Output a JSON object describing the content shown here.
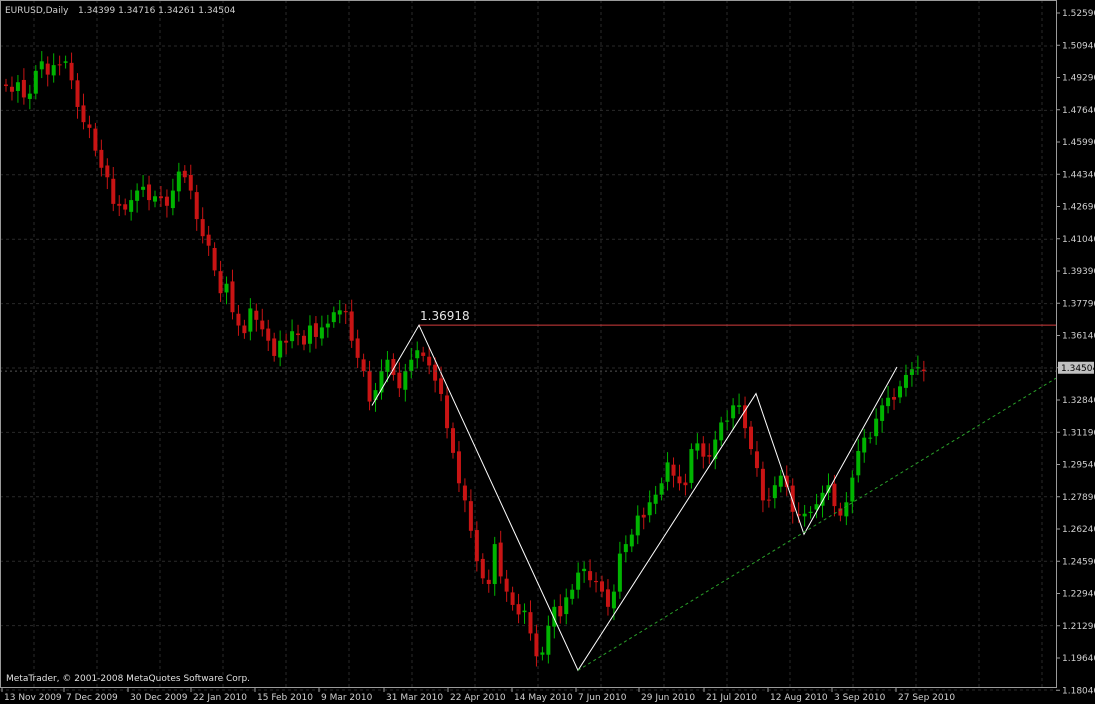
{
  "header": {
    "symbol": "EURUSD,Daily",
    "ohlc": "1.34399 1.34716 1.34261 1.34504"
  },
  "watermark": "MetaTrader, © 2001-2008 MetaQuotes Software Corp.",
  "colors": {
    "background": "#000000",
    "grid": "#2a2a2a",
    "bull": "#00b400",
    "bear": "#c81414",
    "zigzag": "#ffffff",
    "resistance": "#d23c3c",
    "trend": "#2aa02a",
    "price_bg": "#c0c0c0"
  },
  "chart_data": {
    "type": "candlestick",
    "ylim": [
      1.1804,
      1.5329
    ],
    "y_ticks": [
      "1.52590",
      "1.50940",
      "1.49290",
      "1.47640",
      "1.45990",
      "1.44340",
      "1.42690",
      "1.41040",
      "1.39390",
      "1.37790",
      "1.36140",
      "1.34504",
      "1.32840",
      "1.31190",
      "1.29540",
      "1.27890",
      "1.26240",
      "1.24590",
      "1.22940",
      "1.21290",
      "1.19640",
      "1.18040"
    ],
    "current_price": "1.34504",
    "x_labels": [
      "13 Nov 2009",
      "7 Dec 2009",
      "30 Dec 2009",
      "22 Jan 2010",
      "15 Feb 2010",
      "9 Mar 2010",
      "31 Mar 2010",
      "22 Apr 2010",
      "14 May 2010",
      "7 Jun 2010",
      "29 Jun 2010",
      "21 Jul 2010",
      "12 Aug 2010",
      "3 Sep 2010",
      "27 Sep 2010"
    ],
    "candle_count": 233,
    "closes": [
      1.495,
      1.492,
      1.497,
      1.489,
      1.491,
      1.503,
      1.508,
      1.501,
      1.506,
      1.506,
      1.508,
      1.498,
      1.484,
      1.476,
      1.473,
      1.461,
      1.452,
      1.447,
      1.433,
      1.432,
      1.43,
      1.435,
      1.44,
      1.442,
      1.435,
      1.437,
      1.436,
      1.432,
      1.44,
      1.45,
      1.447,
      1.44,
      1.425,
      1.416,
      1.411,
      1.398,
      1.386,
      1.391,
      1.376,
      1.369,
      1.365,
      1.378,
      1.372,
      1.367,
      1.361,
      1.353,
      1.361,
      1.36,
      1.366,
      1.364,
      1.359,
      1.369,
      1.363,
      1.368,
      1.37,
      1.376,
      1.377,
      1.376,
      1.361,
      1.352,
      1.345,
      1.329,
      1.335,
      1.345,
      1.351,
      1.343,
      1.336,
      1.345,
      1.351,
      1.356,
      1.353,
      1.348,
      1.34,
      1.333,
      1.315,
      1.302,
      1.286,
      1.277,
      1.261,
      1.245,
      1.236,
      1.233,
      1.254,
      1.237,
      1.229,
      1.222,
      1.217,
      1.219,
      1.207,
      1.195,
      1.197,
      1.211,
      1.221,
      1.216,
      1.226,
      1.23,
      1.239,
      1.241,
      1.235,
      1.234,
      1.229,
      1.221,
      1.229,
      1.249,
      1.254,
      1.259,
      1.269,
      1.268,
      1.276,
      1.28,
      1.286,
      1.297,
      1.29,
      1.286,
      1.285,
      1.304,
      1.307,
      1.3,
      1.3,
      1.309,
      1.318,
      1.319,
      1.327,
      1.327,
      1.315,
      1.304,
      1.294,
      1.277,
      1.277,
      1.285,
      1.29,
      1.284,
      1.271,
      1.269,
      1.27,
      1.271,
      1.275,
      1.281,
      1.285,
      1.274,
      1.269,
      1.276,
      1.289,
      1.303,
      1.31,
      1.31,
      1.32,
      1.327,
      1.331,
      1.33,
      1.337,
      1.343,
      1.346,
      1.347,
      1.345
    ],
    "resistance": {
      "label": "1.36918",
      "value": 1.36918
    },
    "zigzag": [
      {
        "i": 0,
        "v": 1.3269
      },
      {
        "i": 11,
        "v": 1.36918
      },
      {
        "i": 38,
        "v": 1.1876
      },
      {
        "i": 80,
        "v": 1.3332
      },
      {
        "i": 94,
        "v": 1.2592
      },
      {
        "i": 116,
        "v": 1.3472
      }
    ],
    "trendline": [
      {
        "i": 38,
        "v": 1.1876
      },
      {
        "i": 170,
        "v": 1.3413
      }
    ]
  }
}
